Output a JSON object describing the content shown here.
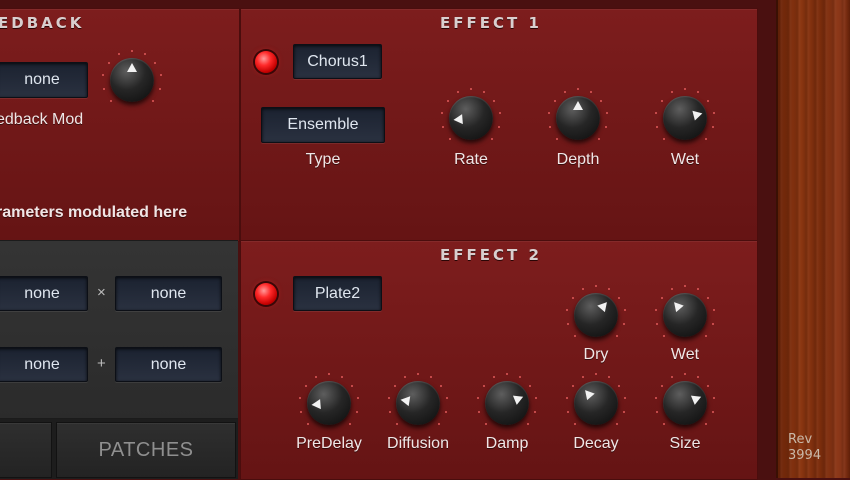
{
  "feedback": {
    "title": "EDBACK",
    "source_value": "none",
    "mod_label": "edback Mod",
    "footer_text": "rameters modulated here"
  },
  "mod_matrix": {
    "row1": {
      "a": "none",
      "op": "×",
      "b": "none"
    },
    "row2": {
      "a": "none",
      "op": "+",
      "b": "none"
    }
  },
  "tabs": {
    "patches_label": "PATCHES"
  },
  "effect1": {
    "title": "EFFECT 1",
    "enabled": true,
    "preset": "Chorus1",
    "type_value": "Ensemble",
    "type_label": "Type",
    "knobs": [
      {
        "label": "Rate",
        "value": 0.15
      },
      {
        "label": "Depth",
        "value": 0.5
      },
      {
        "label": "Wet",
        "value": 0.78
      }
    ]
  },
  "effect2": {
    "title": "EFFECT 2",
    "enabled": true,
    "preset": "Plate2",
    "top_knobs": [
      {
        "label": "Dry",
        "value": 0.65
      },
      {
        "label": "Wet",
        "value": 0.35
      }
    ],
    "bottom_knobs": [
      {
        "label": "PreDelay",
        "value": 0.15
      },
      {
        "label": "Diffusion",
        "value": 0.2
      },
      {
        "label": "Damp",
        "value": 0.75
      },
      {
        "label": "Decay",
        "value": 0.35
      },
      {
        "label": "Size",
        "value": 0.75
      }
    ]
  },
  "footer": {
    "rev_label": "Rev",
    "rev_number": "3994"
  },
  "colors": {
    "panel_red": "#701818",
    "led_red": "#ff2a2a",
    "lcd_bg": "#1b2230"
  }
}
